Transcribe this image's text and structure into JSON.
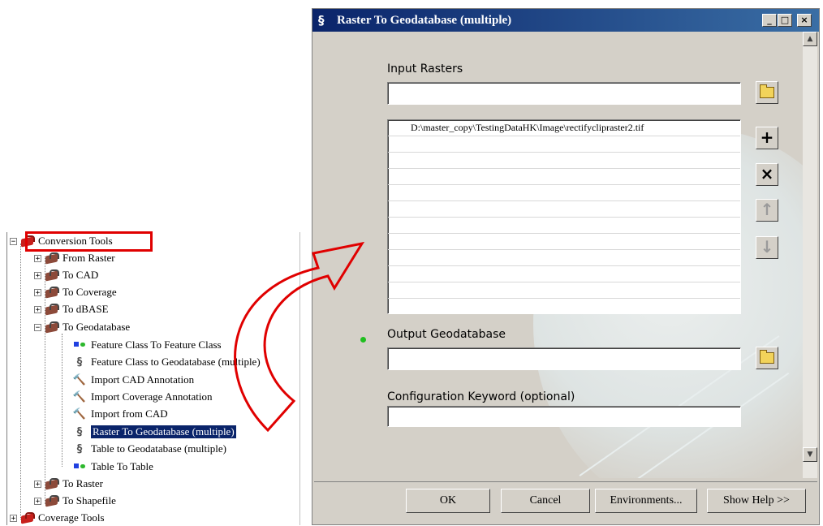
{
  "tree": {
    "root_label": "Conversion Tools",
    "toolsets": [
      {
        "label": "From Raster"
      },
      {
        "label": "To CAD"
      },
      {
        "label": "To Coverage"
      },
      {
        "label": "To dBASE"
      },
      {
        "label": "To Geodatabase"
      }
    ],
    "geodatabase_tools": [
      {
        "label": "Feature Class To Feature Class",
        "icon": "model-icon"
      },
      {
        "label": "Feature Class to Geodatabase (multiple)",
        "icon": "script-icon"
      },
      {
        "label": "Import CAD Annotation",
        "icon": "hammer-icon"
      },
      {
        "label": "Import Coverage Annotation",
        "icon": "hammer-icon"
      },
      {
        "label": "Import from CAD",
        "icon": "hammer-icon"
      },
      {
        "label": "Raster To Geodatabase (multiple)",
        "icon": "script-icon",
        "selected": true
      },
      {
        "label": "Table to Geodatabase (multiple)",
        "icon": "script-icon"
      },
      {
        "label": "Table To Table",
        "icon": "model-icon"
      }
    ],
    "after_toolsets": [
      {
        "label": "To Raster"
      },
      {
        "label": "To Shapefile"
      }
    ],
    "next_root_label": "Coverage Tools"
  },
  "dialog": {
    "title": "Raster To Geodatabase (multiple)",
    "input_rasters_label": "Input Rasters",
    "input_rasters_value": "",
    "raster_list": [
      "D:\\master_copy\\TestingDataHK\\Image\\rectifyclipraster2.tif"
    ],
    "output_geodatabase_label": "Output Geodatabase",
    "output_geodatabase_value": "",
    "config_keyword_label": "Configuration Keyword (optional)",
    "config_keyword_value": "",
    "buttons": {
      "ok": "OK",
      "cancel": "Cancel",
      "environments": "Environments...",
      "show_help": "Show Help >>"
    }
  },
  "colors": {
    "highlight_box": "#e00000",
    "selection": "#0a246a",
    "title_bar": "#0a246a",
    "required_dot": "#1fbf1f"
  }
}
